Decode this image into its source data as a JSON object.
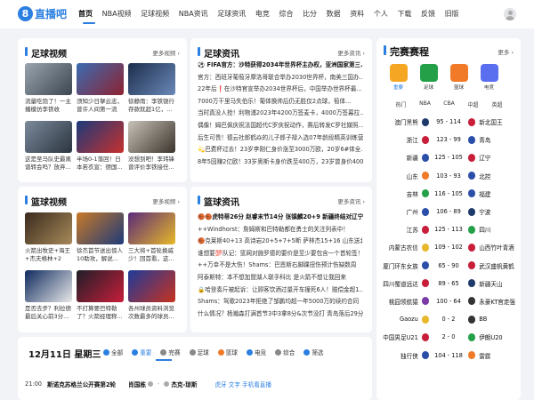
{
  "brand": {
    "mark": "8",
    "name": "直播吧"
  },
  "nav": [
    "首页",
    "NBA视频",
    "足球视频",
    "NBA资讯",
    "足球资讯",
    "电竞",
    "综合",
    "比分",
    "数据",
    "资料",
    "个人",
    "下载",
    "反馈",
    "旧版"
  ],
  "football_videos": {
    "title": "足球视频",
    "more": "更多视频 ›",
    "items": [
      {
        "caption": "流量吃饱了！一主播模仿李铁收头，..."
      },
      {
        "caption": "须知少日拏云志，曾许人间第一流"
      },
      {
        "caption": "徐静雨：李铁银行存款就超1亿，..."
      },
      {
        "caption": "这是至马队史最离谱转会吗？放弃..."
      },
      {
        "caption": "半场0-1落回！日本若衣宣：德国..."
      },
      {
        "caption": "没想到吧！李玮锋曾评价李铁接任..."
      }
    ]
  },
  "football_news": {
    "title": "足球资讯",
    "more": "更多资讯 ›",
    "items": [
      "⚽ FIFA官方：沙特获得2034年世界杯主办权，亚洲国家第三...",
      "官方：西班牙葡萄牙摩洛哥联合举办2030世界杯，南美三国办...",
      "22年后❗在沙特官宣举办2034世界杯后，中国举办世界杯最...",
      "7000万干里马失伯乐！葡体换帅后仍无胜仅2点球，萄体...",
      "当时真没人抢！利物浦2023年4200万签麦卡，4000万签暮拉...",
      "偶像！姆巴佩庆祝法国超代C罗庆祝动作，赛后转发C罗社媒照...",
      "后生可畏！德云社郎鹤焱的儿子郎子禄入选07年龄段精英训练营",
      "💫巴费杯过去！23岁李刚仁身价涨至3000万欧，20岁6#体全...",
      "8年5囧赚2亿欧！33岁奥斯卡身价跌至400万，23岁曾身价400..."
    ]
  },
  "basketball_videos": {
    "title": "篮球视频",
    "more": "更多视频 ›",
    "items": [
      {
        "caption": "火箭出牧史+海王+杰夫格林+2首..."
      },
      {
        "caption": "徐杰首节送出惊人10助攻，解说..."
      },
      {
        "caption": "三大将+首轮换威少！回首看，这..."
      },
      {
        "caption": "是否去步？利拉德最后关心前3分..."
      },
      {
        "caption": "不打算要巴特勒了？火箭经理称..."
      },
      {
        "caption": "各州球员资料浏览次数最多的球员..."
      }
    ]
  },
  "basketball_news": {
    "title": "篮球资讯",
    "more": "更多资讯 ›",
    "items": [
      "🏀🏀虎特蒂26分 赵睿末节14分 张镇麟20+9 新疆终结对辽宁...",
      "++Windhorst：詹姆斯和巴特勒都在勇士的关注列表中！",
      "🏀克莱斯40+13 高诗岩20+5+7+5断 萨林杰15+16 山东送北控...",
      "谁想要💯队记：篮网对施罗德的要价是至少要包含一个首轮签！",
      "++万幸不是大伤！Shams：巴恩斯右脚踝扭伤预计伤缺数周",
      "阿泰斯特：本不想加盟湖人联手科比 是火箭不想让我回来",
      "🔒哈登奏斤被起诉：让顾客饮酒过量开车撞死6人！赔偿金超1...",
      "Shams：驾歌2023年拒绝了邹鹏均超一年5000万的续约合同",
      "什么情况？杨瀚森打满首节3中3拿8分&次节没打 青岛落后29分"
    ]
  },
  "schedule": {
    "date": "12月11日 星期三",
    "filters": [
      "全部",
      "重要",
      "完赛",
      "足球",
      "篮球",
      "电竞",
      "综合",
      "筛选"
    ],
    "match": {
      "time": "21:00",
      "league": "斯诺克苏格兰公开赛第2轮",
      "home": "肖国栋",
      "away": "杰克-琼斯",
      "sep": "-",
      "casts": "虎牙 文字 手机看直播"
    }
  },
  "fixtures": {
    "title": "完赛赛程",
    "more": "更多 ›",
    "sports": [
      {
        "label": "重要"
      },
      {
        "label": "足球"
      },
      {
        "label": "篮球"
      },
      {
        "label": "电竞"
      }
    ],
    "leagues": [
      "热门",
      "NBA",
      "CBA",
      "中超",
      "英超"
    ],
    "matches": [
      {
        "home": "澳门黑熊",
        "score": "95 - 114",
        "away": "新北国王"
      },
      {
        "home": "浙江",
        "score": "123 - 99",
        "away": "青岛"
      },
      {
        "home": "新疆",
        "score": "125 - 105",
        "away": "辽宁"
      },
      {
        "home": "山东",
        "score": "103 - 93",
        "away": "北控"
      },
      {
        "home": "吉林",
        "score": "116 - 105",
        "away": "福建"
      },
      {
        "home": "广州",
        "score": "106 - 89",
        "away": "宁波"
      },
      {
        "home": "江苏",
        "score": "125 - 113",
        "away": "四川"
      },
      {
        "home": "内蒙古农信",
        "score": "109 - 102",
        "away": "山西竹叶青酒"
      },
      {
        "home": "厦门环东女族",
        "score": "65 - 90",
        "away": "武汉盛帆黄鹤"
      },
      {
        "home": "四川蜀道远达",
        "score": "89 - 65",
        "away": "新疆天山"
      },
      {
        "home": "桃园领航猿",
        "score": "100 - 64",
        "away": "永豪KT官走强"
      },
      {
        "home": "Gaozu",
        "score": "0 - 2",
        "away": "BB"
      },
      {
        "home": "中国男足U21",
        "score": "2 - 0",
        "away": "伊朗U20"
      },
      {
        "home": "独行侠",
        "score": "104 - 118",
        "away": "雷霆"
      }
    ]
  }
}
